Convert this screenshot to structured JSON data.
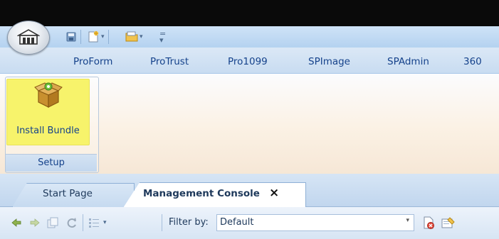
{
  "colors": {
    "accent": "#15428b",
    "highlight": "#f7f36b",
    "titlebar": "#0a0a0a"
  },
  "icons": {
    "app_orb": "building-icon",
    "qat": [
      "save-icon",
      "new-document-icon",
      "open-folder-icon",
      "customize-qat-icon"
    ],
    "install_bundle": "package-box-icon",
    "toolbar": [
      "back-arrow-icon",
      "forward-arrow-icon",
      "copy-icon",
      "refresh-icon",
      "list-view-icon",
      "delete-icon",
      "properties-icon"
    ]
  },
  "ribbon_tabs": [
    "ProForm",
    "ProTrust",
    "Pro1099",
    "SPImage",
    "SPAdmin",
    "360"
  ],
  "setup_group": {
    "label": "Setup",
    "install_button": "Install Bundle"
  },
  "doc_tabs": {
    "start_page": "Start Page",
    "management_console": "Management Console",
    "close": "×"
  },
  "toolbar": {
    "filter_label": "Filter by:",
    "filter_value": "Default"
  }
}
